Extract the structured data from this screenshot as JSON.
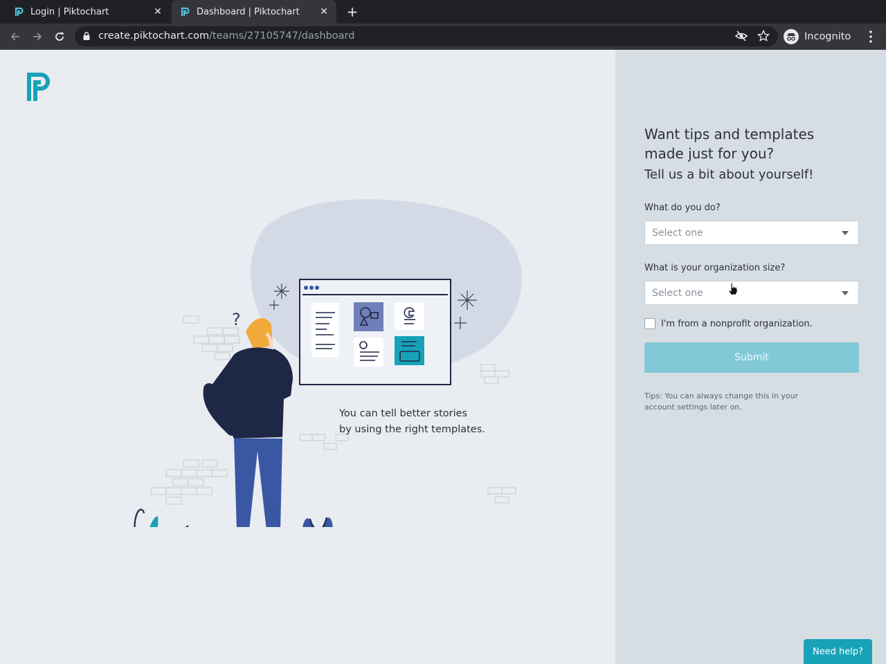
{
  "browser": {
    "tabs": [
      {
        "title": "Login | Piktochart",
        "active": false
      },
      {
        "title": "Dashboard | Piktochart",
        "active": true
      }
    ],
    "url_host": "create.piktochart.com",
    "url_path": "/teams/27105747/dashboard",
    "profile_label": "Incognito"
  },
  "illustration": {
    "caption_line1": "You can tell better stories",
    "caption_line2": "by using the right templates."
  },
  "form": {
    "headline_line1": "Want tips and templates",
    "headline_line2": "made just for you?",
    "subheadline": "Tell us a bit about yourself!",
    "role_label": "What do you do?",
    "role_value": "Select one",
    "org_size_label": "What is your organization size?",
    "org_size_value": "Select one",
    "nonprofit_label": "I'm from a nonprofit organization.",
    "nonprofit_checked": false,
    "submit_label": "Submit",
    "tips_text": "Tips: You can always change this in your account settings later on."
  },
  "help_button_label": "Need help?",
  "colors": {
    "brand_teal": "#17a2b8",
    "submit_disabled": "#83c8d7",
    "navy": "#1f2746",
    "jeans_blue": "#3a57a3"
  }
}
